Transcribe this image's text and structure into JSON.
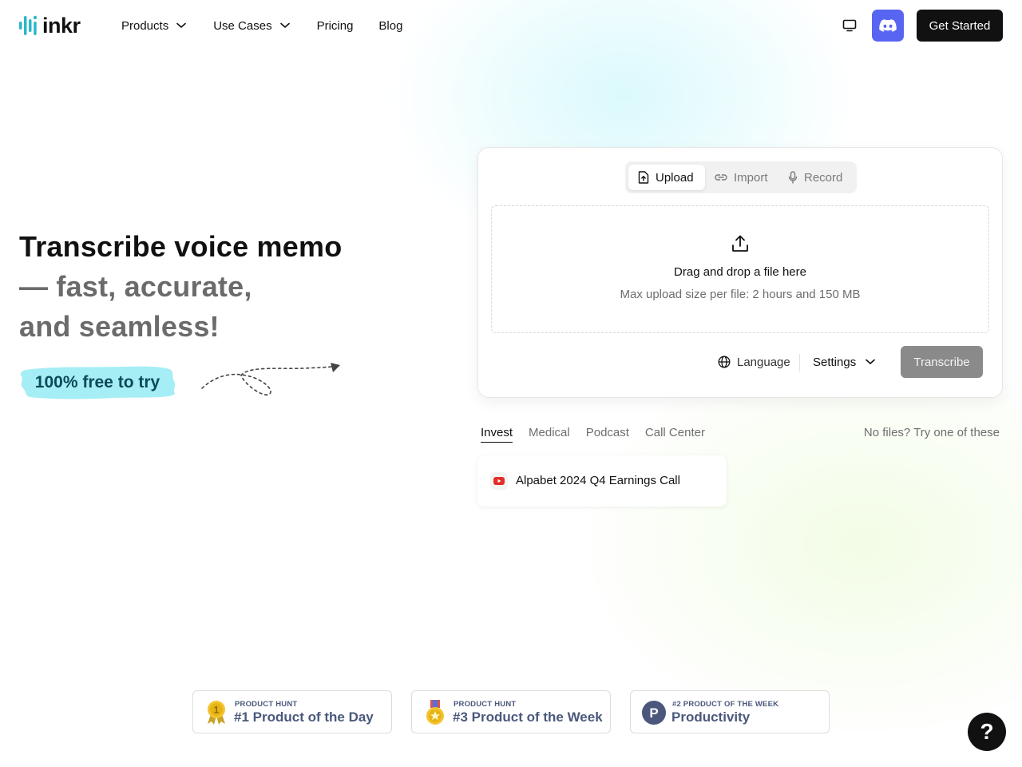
{
  "colors": {
    "discord": "#5865f2",
    "primary_button": "#111111",
    "transcribe_disabled": "#8a8a8a",
    "badge_blue": "#a5eef5",
    "product_hunt_text": "#4b587c"
  },
  "header": {
    "logo_text": "inkr",
    "nav": {
      "products": "Products",
      "use_cases": "Use Cases",
      "pricing": "Pricing",
      "blog": "Blog"
    },
    "icons": [
      "monitor-icon",
      "discord-icon"
    ],
    "cta": "Get Started"
  },
  "hero": {
    "line1": "Transcribe voice memo",
    "line2a": "— fast, accurate,",
    "line2b": "and seamless!",
    "badge": "100% free to try"
  },
  "uploader": {
    "tabs": {
      "upload": "Upload",
      "import": "Import",
      "record": "Record"
    },
    "drop_title": "Drag and drop a file here",
    "drop_subtitle": "Max upload size per file: 2 hours and 150 MB",
    "language": "Language",
    "settings": "Settings",
    "transcribe": "Transcribe"
  },
  "samples": {
    "categories": [
      "Invest",
      "Medical",
      "Podcast",
      "Call Center"
    ],
    "active_category": "Invest",
    "hint": "No files? Try one of these",
    "items": [
      {
        "title": "Alpabet 2024 Q4 Earnings Call",
        "icon": "youtube-icon"
      }
    ]
  },
  "badges": [
    {
      "small": "PRODUCT HUNT",
      "big": "#1 Product of the Day",
      "icon": "gold-medal-icon",
      "icon_text": "1"
    },
    {
      "small": "PRODUCT HUNT",
      "big": "#3 Product of the Week",
      "icon": "star-medal-icon"
    },
    {
      "small": "#2 PRODUCT OF THE WEEK",
      "big": "Productivity",
      "icon": "product-hunt-logo-icon",
      "icon_text": "P"
    }
  ],
  "help": "?"
}
